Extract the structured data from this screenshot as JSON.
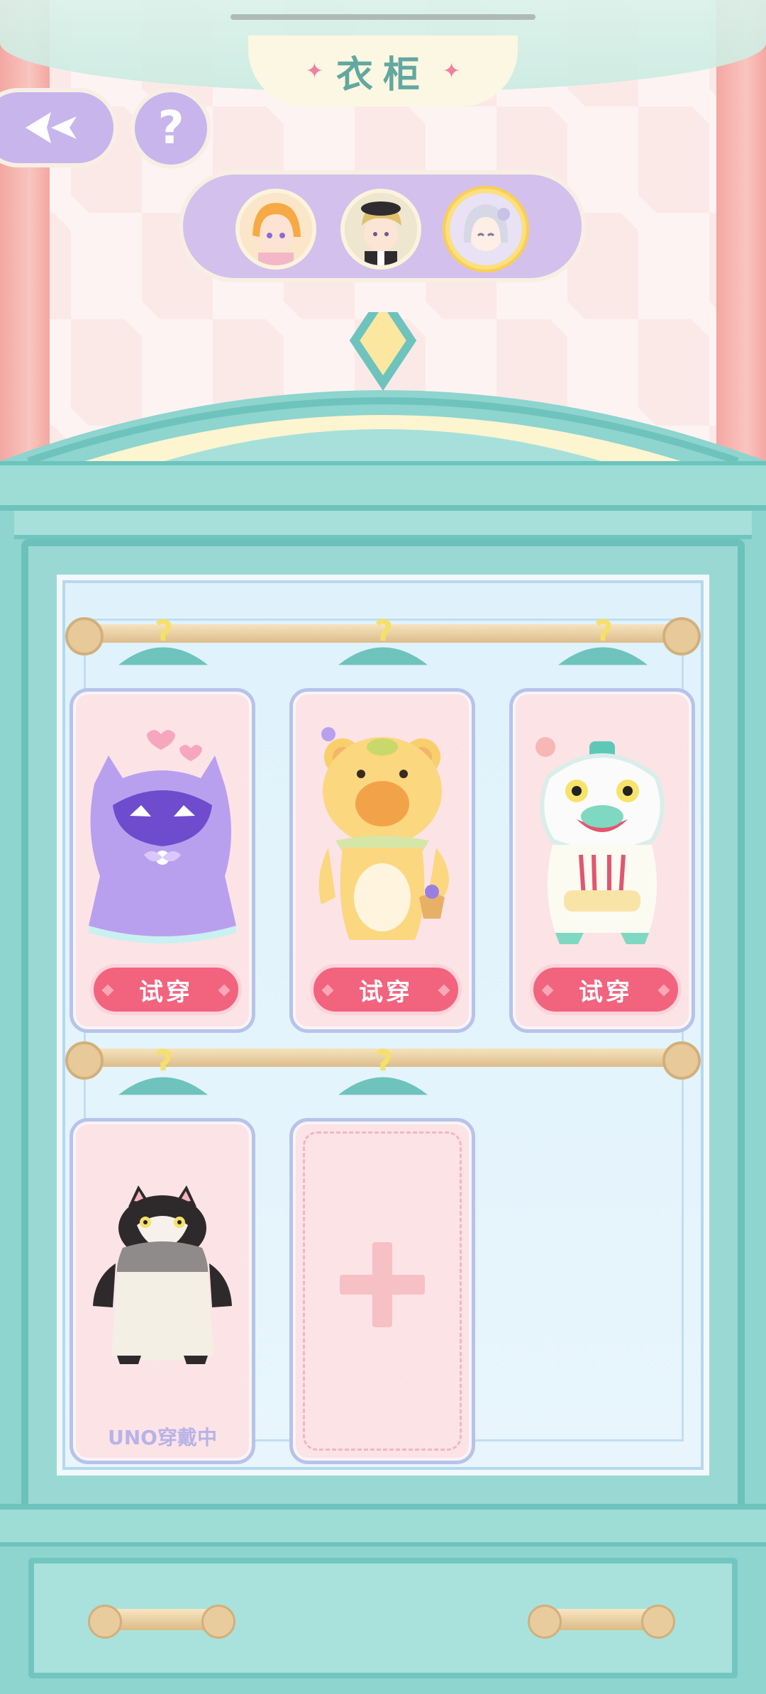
{
  "header": {
    "title": "衣柜",
    "title_deco_left": "✦",
    "title_deco_right": "✦"
  },
  "buttons": {
    "help_label": "?"
  },
  "characters": [
    {
      "name": "character-1",
      "selected": false
    },
    {
      "name": "character-2",
      "selected": false
    },
    {
      "name": "character-3",
      "selected": true
    }
  ],
  "outfits": [
    {
      "name": "purple-cat-cloak",
      "action_label": "试穿"
    },
    {
      "name": "bear-costume",
      "action_label": "试穿"
    },
    {
      "name": "lion-dance-costume",
      "action_label": "试穿"
    },
    {
      "name": "cat-sack-costume",
      "status_label": "UNO穿戴中"
    }
  ],
  "colors": {
    "accent": "#f2637e",
    "wardrobe": "#8ed4cf",
    "title": "#62a8a0",
    "switcher": "#d4c0ec"
  }
}
